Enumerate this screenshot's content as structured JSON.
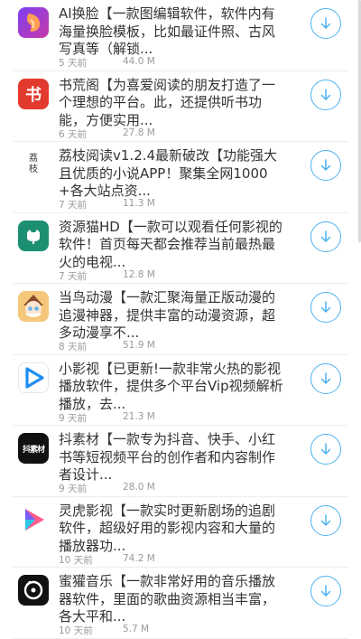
{
  "apps": [
    {
      "icon": "ai-face-swap-icon",
      "desc": "AI换脸【一款图编辑软件，软件内有海量换脸模板，比如最证件照、古风写真等（解锁...",
      "time": "5 天前",
      "size": "44.0 M"
    },
    {
      "icon": "shuhuang-book-icon",
      "desc": "书荒阁【为喜爱阅读的朋友打造了一个理想的平台。此，还提供听书功能，方便实用...",
      "time": "6 天前",
      "size": "27.8 M"
    },
    {
      "icon": "lizhi-reading-icon",
      "desc": "荔枝阅读v1.2.4最新破改【功能强大且优质的小说APP！聚集全网1000+各大站点资...",
      "time": "7 天前",
      "size": "11.3 M"
    },
    {
      "icon": "ziyuanmao-cat-icon",
      "desc": "资源猫HD【一款可以观看任何影视的软件！首页每天都会推荐当前最热最火的电视...",
      "time": "7 天前",
      "size": "12.8 M"
    },
    {
      "icon": "dangniao-anime-icon",
      "desc": "当鸟动漫【一款汇聚海量正版动漫的追漫神器，提供丰富的动漫资源，超多动漫享不...",
      "time": "8 天前",
      "size": "51.9 M"
    },
    {
      "icon": "xiaoyingshi-play-icon",
      "desc": "小影视【已更新!一款非常火热的影视播放软件，提供多个平台Vip视频解析播放，去...",
      "time": "9 天前",
      "size": "21.3 M"
    },
    {
      "icon": "douyin-material-icon",
      "desc": "抖素材【一款专为抖音、快手、小红书等短视频平台的创作者和内容制作者设计...",
      "time": "9 天前",
      "size": "28.0 M"
    },
    {
      "icon": "linghu-play-icon",
      "desc": "灵虎影视【一款实时更新剧场的追剧软件，超级好用的影视内容和大量的播放器功...",
      "time": "10 天前",
      "size": "74.2 M"
    },
    {
      "icon": "mihuan-music-icon",
      "desc": "蜜獾音乐【一款非常好用的音乐播放器软件，里面的歌曲资源相当丰富，各大平和...",
      "time": "10 天前",
      "size": "5.7 M"
    }
  ],
  "icon_text": {
    "shuhuang": "书",
    "lizhi": "荔\n枝",
    "douyin": "抖素材"
  },
  "colors": {
    "accent": "#4db2f0",
    "meta": "#9a9a9a",
    "text": "#333333"
  }
}
